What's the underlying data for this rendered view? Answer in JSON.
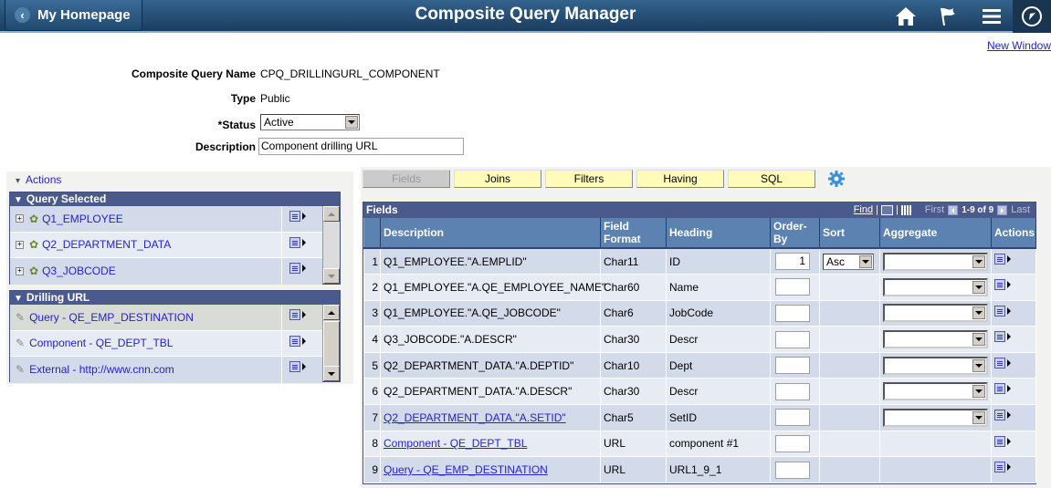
{
  "topbar": {
    "home_label": "My Homepage",
    "title": "Composite Query Manager",
    "icons": [
      "home-icon",
      "notification-flag-icon",
      "menu-icon",
      "navbar-compass-icon"
    ]
  },
  "new_window_label": "New Window",
  "form": {
    "name_label": "Composite Query Name",
    "name_value": "CPQ_DRILLINGURL_COMPONENT",
    "type_label": "Type",
    "type_value": "Public",
    "status_label": "*Status",
    "status_value": "Active",
    "description_label": "Description",
    "description_value": "Component drilling URL"
  },
  "left_panel": {
    "actions_label": "Actions",
    "query_selected": {
      "title": "Query Selected",
      "items": [
        {
          "label": "Q1_EMPLOYEE"
        },
        {
          "label": "Q2_DEPARTMENT_DATA"
        },
        {
          "label": "Q3_JOBCODE"
        }
      ]
    },
    "drilling_url": {
      "title": "Drilling URL",
      "items": [
        {
          "label": "Query - QE_EMP_DESTINATION"
        },
        {
          "label": "Component - QE_DEPT_TBL"
        },
        {
          "label": "External - http://www.cnn.com"
        }
      ]
    }
  },
  "tabs": [
    {
      "label": "Fields",
      "disabled": true
    },
    {
      "label": "Joins"
    },
    {
      "label": "Filters"
    },
    {
      "label": "Having"
    },
    {
      "label": "SQL"
    }
  ],
  "fields_grid": {
    "title": "Fields",
    "find_label": "Find",
    "first_label": "First",
    "range_label": "1-9 of 9",
    "last_label": "Last",
    "columns": [
      "",
      "Description",
      "Field Format",
      "Heading",
      "Order-By",
      "Sort",
      "Aggregate",
      "Actions"
    ],
    "rows": [
      {
        "num": "1",
        "description": "Q1_EMPLOYEE.\"A.EMPLID\"",
        "link": false,
        "format": "Char11",
        "heading": "ID",
        "order_by": "1",
        "sort": "Asc",
        "aggregate": ""
      },
      {
        "num": "2",
        "description": "Q1_EMPLOYEE.\"A.QE_EMPLOYEE_NAME\"",
        "link": false,
        "format": "Char60",
        "heading": "Name",
        "order_by": "",
        "sort": null,
        "aggregate": ""
      },
      {
        "num": "3",
        "description": "Q1_EMPLOYEE.\"A.QE_JOBCODE\"",
        "link": false,
        "format": "Char6",
        "heading": "JobCode",
        "order_by": "",
        "sort": null,
        "aggregate": ""
      },
      {
        "num": "4",
        "description": "Q3_JOBCODE.\"A.DESCR\"",
        "link": false,
        "format": "Char30",
        "heading": "Descr",
        "order_by": "",
        "sort": null,
        "aggregate": ""
      },
      {
        "num": "5",
        "description": "Q2_DEPARTMENT_DATA.\"A.DEPTID\"",
        "link": false,
        "format": "Char10",
        "heading": "Dept",
        "order_by": "",
        "sort": null,
        "aggregate": ""
      },
      {
        "num": "6",
        "description": "Q2_DEPARTMENT_DATA.\"A.DESCR\"",
        "link": false,
        "format": "Char30",
        "heading": "Descr",
        "order_by": "",
        "sort": null,
        "aggregate": ""
      },
      {
        "num": "7",
        "description": "Q2_DEPARTMENT_DATA.\"A.SETID\"",
        "link": true,
        "format": "Char5",
        "heading": "SetID",
        "order_by": "",
        "sort": null,
        "aggregate": ""
      },
      {
        "num": "8",
        "description": "Component - QE_DEPT_TBL",
        "link": true,
        "format": "URL",
        "heading": "component #1",
        "order_by": "",
        "sort": null,
        "aggregate": null
      },
      {
        "num": "9",
        "description": "Query - QE_EMP_DESTINATION",
        "link": true,
        "format": "URL",
        "heading": "URL1_9_1",
        "order_by": "",
        "sort": null,
        "aggregate": null
      }
    ]
  }
}
